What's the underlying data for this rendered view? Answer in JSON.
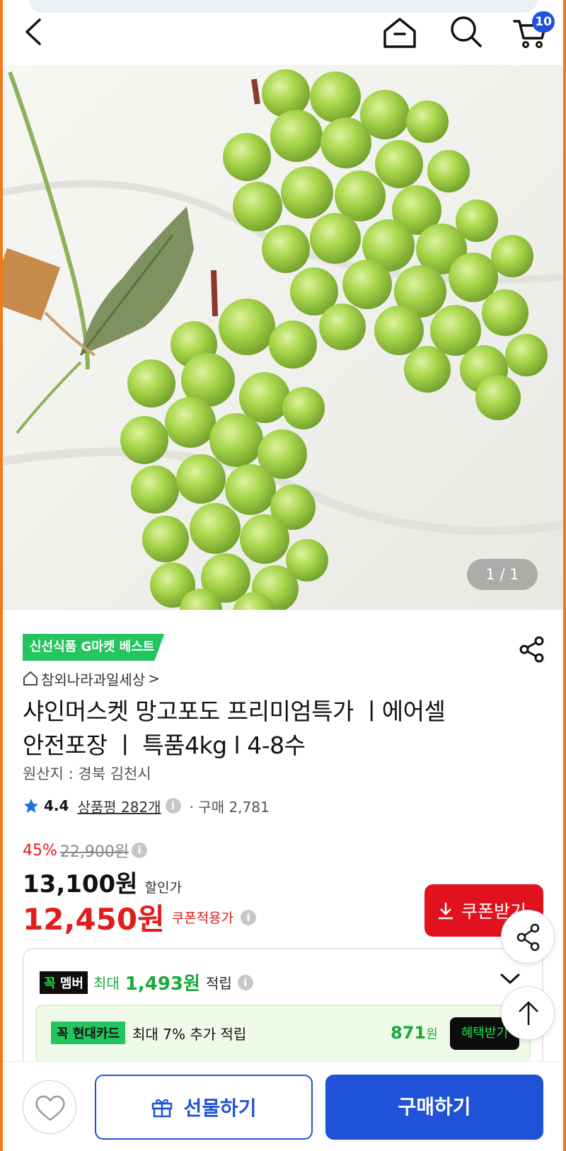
{
  "header": {
    "cart_count": "10",
    "icons": [
      "back-icon",
      "home-icon",
      "search-icon",
      "cart-icon"
    ]
  },
  "hero": {
    "counter": "1 / 1",
    "image_alt": "green grapes"
  },
  "product": {
    "badge": "신선식품 G마켓 베스트",
    "seller": "참외나라과일세상",
    "seller_chevron": ">",
    "title_line1": "샤인머스켓 망고포도 프리미엄특가 ㅣ에어셀",
    "title_line2": "안전포장 ㅣ 특품4kg l 4-8수",
    "origin": "원산지 : 경북 김천시",
    "rating": "4.4",
    "reviews": "상품평 282개",
    "purchases": "· 구매 2,781"
  },
  "price": {
    "discount_pct": "45%",
    "original": "22,900원",
    "sale": "13,100원",
    "sale_label": "할인가",
    "coupon_price": "12,450원",
    "coupon_label": "쿠폰적용가",
    "coupon_button": "쿠폰받기"
  },
  "benefits": {
    "member_tag_prefix": "꼭",
    "member_tag": "멤버",
    "member_max": "최대",
    "member_amount": "1,493원",
    "member_suffix": "적립",
    "card_tag_prefix": "꼭",
    "card_tag": "현대카드",
    "card_text": "최대 7% 추가 적립",
    "card_amount": "871",
    "card_unit": "원",
    "card_button": "혜택받기"
  },
  "bottom": {
    "gift_label": "선물하기",
    "buy_label": "구매하기"
  },
  "colors": {
    "accent_blue": "#1f52d8",
    "sale_red": "#e11d1d",
    "green": "#22c55e"
  }
}
